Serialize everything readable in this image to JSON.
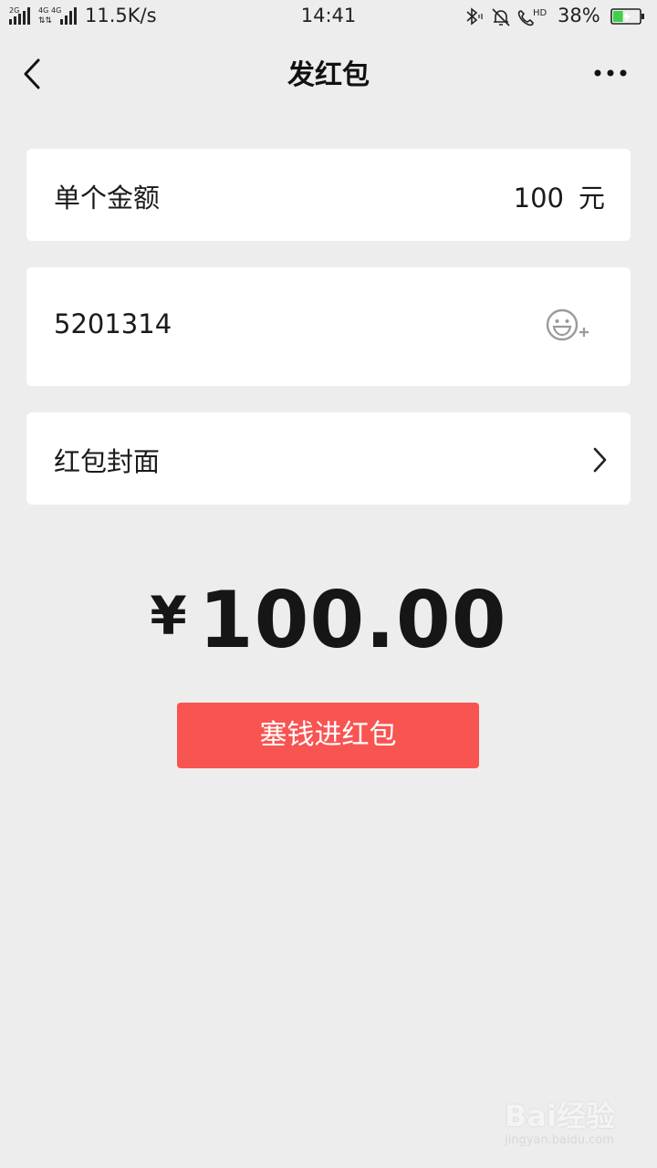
{
  "status_bar": {
    "signal_labels": [
      "2G",
      "4G",
      "4G"
    ],
    "net_speed": "11.5K/s",
    "time": "14:41",
    "hd_label": "HD",
    "battery_percent": "38%",
    "battery_level": 0.38,
    "icons": [
      "signal-icon",
      "bluetooth-icon",
      "mute-bell-icon",
      "hd-call-icon",
      "battery-icon"
    ]
  },
  "nav": {
    "title": "发红包",
    "back_icon": "chevron-left-icon",
    "more_icon": "more-dots-icon"
  },
  "amount_row": {
    "label": "单个金额",
    "value": "100",
    "unit": "元"
  },
  "message_row": {
    "value": "5201314",
    "icon": "emoji-add-icon"
  },
  "cover_row": {
    "label": "红包封面",
    "icon": "chevron-right-icon"
  },
  "total": {
    "currency": "¥",
    "amount": "100.00"
  },
  "send_button": {
    "label": "塞钱进红包",
    "color": "#f85452"
  },
  "watermark": {
    "logo": "Bai经验",
    "url": "jingyan.baidu.com"
  },
  "colors": {
    "background": "#ededed",
    "card": "#ffffff",
    "accent": "#f85452",
    "battery_fill": "#3fcf4a"
  }
}
